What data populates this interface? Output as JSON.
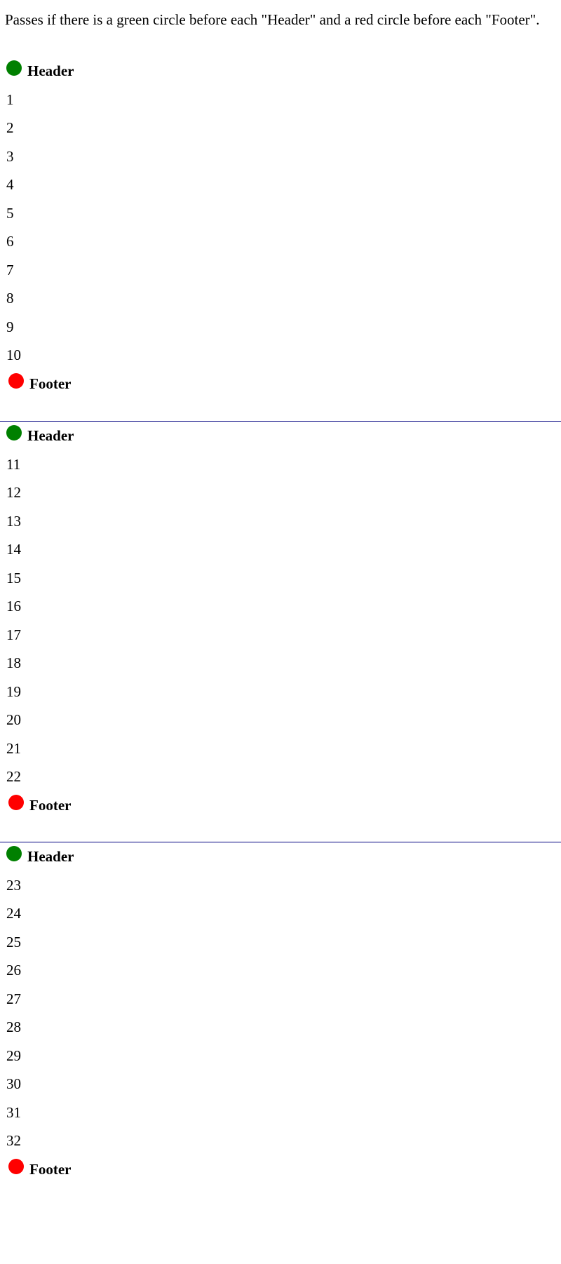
{
  "intro_text": "Passes if there is a green circle before each \"Header\" and a red circle before each \"Footer\".",
  "colors": {
    "header_dot": "#008000",
    "footer_dot": "#ff0000",
    "divider": "#000080"
  },
  "header_label": "Header",
  "footer_label": "Footer",
  "pages": [
    {
      "items": [
        "1",
        "2",
        "3",
        "4",
        "5",
        "6",
        "7",
        "8",
        "9",
        "10"
      ]
    },
    {
      "items": [
        "11",
        "12",
        "13",
        "14",
        "15",
        "16",
        "17",
        "18",
        "19",
        "20",
        "21",
        "22"
      ]
    },
    {
      "items": [
        "23",
        "24",
        "25",
        "26",
        "27",
        "28",
        "29",
        "30",
        "31",
        "32"
      ]
    }
  ]
}
